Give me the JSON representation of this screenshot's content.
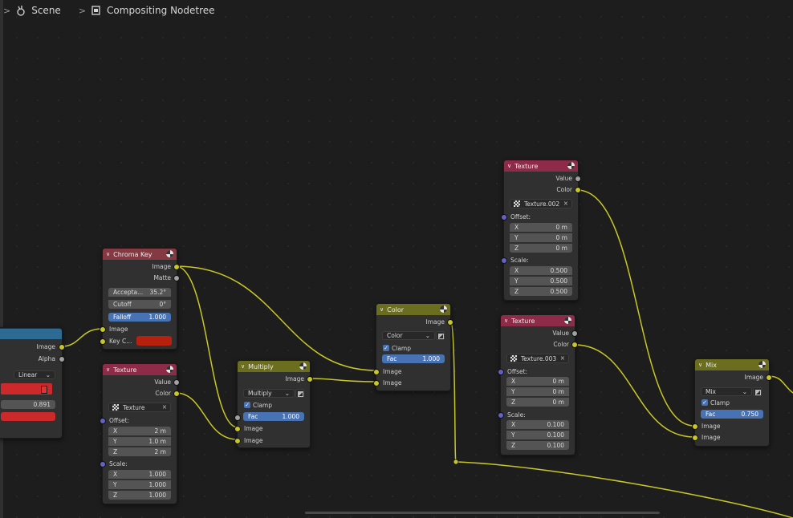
{
  "breadcrumb": {
    "scene": "Scene",
    "nodetree": "Compositing Nodetree"
  },
  "left_node": {
    "image": "Image",
    "alpha": "Alpha",
    "interp": "Linear",
    "value": "0.891"
  },
  "chroma_key": {
    "title": "Chroma Key",
    "out_image": "Image",
    "out_matte": "Matte",
    "acceptance_label": "Accepta...",
    "acceptance_value": "35.2°",
    "cutoff_label": "Cutoff",
    "cutoff_value": "0°",
    "falloff_label": "Falloff",
    "falloff_value": "1.000",
    "in_image": "Image",
    "in_key": "Key C..."
  },
  "texture1": {
    "title": "Texture",
    "out_value": "Value",
    "out_color": "Color",
    "texture": "Texture",
    "offset": "Offset:",
    "ox": "2 m",
    "oy": "1.0 m",
    "oz": "2 m",
    "scale": "Scale:",
    "sx": "1.000",
    "sy": "1.000",
    "sz": "1.000"
  },
  "multiply": {
    "title": "Multiply",
    "out_image": "Image",
    "blend": "Multiply",
    "clamp": "Clamp",
    "fac_label": "Fac",
    "fac_value": "1.000",
    "in_image1": "Image",
    "in_image2": "Image"
  },
  "color_node": {
    "title": "Color",
    "out_image": "Image",
    "blend": "Color",
    "clamp": "Clamp",
    "fac_label": "Fac",
    "fac_value": "1.000",
    "in_image1": "Image",
    "in_image2": "Image"
  },
  "texture2": {
    "title": "Texture",
    "out_value": "Value",
    "out_color": "Color",
    "texture": "Texture.002",
    "offset": "Offset:",
    "ox": "0 m",
    "oy": "0 m",
    "oz": "0 m",
    "scale": "Scale:",
    "sx": "0.500",
    "sy": "0.500",
    "sz": "0.500"
  },
  "texture3": {
    "title": "Texture",
    "out_value": "Value",
    "out_color": "Color",
    "texture": "Texture.003",
    "offset": "Offset:",
    "ox": "0 m",
    "oy": "0 m",
    "oz": "0 m",
    "scale": "Scale:",
    "sx": "0.100",
    "sy": "0.100",
    "sz": "0.100"
  },
  "mix": {
    "title": "Mix",
    "out_image": "Image",
    "blend": "Mix",
    "clamp": "Clamp",
    "fac_label": "Fac",
    "fac_value": "0.750",
    "in_image1": "Image",
    "in_image2": "Image"
  },
  "labels": {
    "x": "X",
    "y": "Y",
    "z": "Z"
  },
  "colors": {
    "texture_header": "#8e2b49",
    "chroma_header": "#853a43",
    "color_header": "#6b6e1e",
    "wire": "#c7c729",
    "field_blue": "#4772b3"
  }
}
